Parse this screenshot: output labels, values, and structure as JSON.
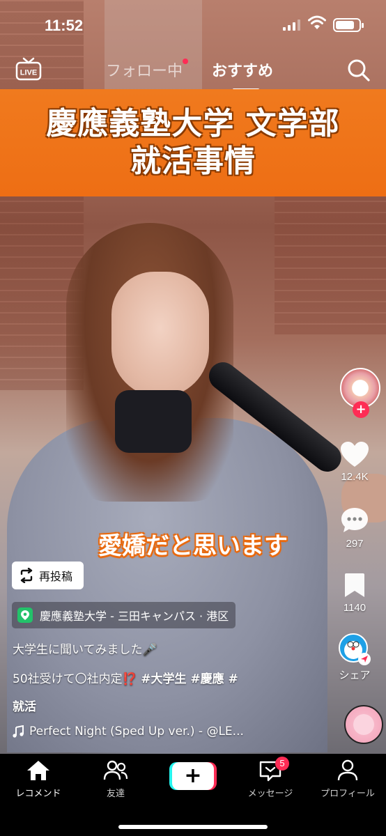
{
  "status_bar": {
    "time": "11:52"
  },
  "top_nav": {
    "live_label": "LIVE",
    "tabs": [
      {
        "label": "フォロー中",
        "has_dot": true
      },
      {
        "label": "おすすめ",
        "active": true
      }
    ]
  },
  "banner": {
    "line1": "慶應義塾大学 文学部",
    "line2": "就活事情"
  },
  "subtitle": "愛嬌だと思います",
  "actions": {
    "likes": "12.4K",
    "comments": "297",
    "bookmarks": "1140",
    "share_label": "シェア"
  },
  "repost": {
    "label": "再投稿"
  },
  "location": {
    "label": "慶應義塾大学 - 三田キャンパス · 港区"
  },
  "caption": {
    "line1": "大学生に聞いてみました🎤",
    "line2_text": "50社受けて〇社内定⁉️",
    "line2_tags": "#大学生 #慶應 #",
    "line3": "就活"
  },
  "music": {
    "text": "Perfect Night (Sped Up ver.) - @LE..."
  },
  "bottom_nav": {
    "items": [
      {
        "label": "レコメンド",
        "active": true
      },
      {
        "label": "友達"
      },
      {
        "label": ""
      },
      {
        "label": "メッセージ",
        "badge": "5"
      },
      {
        "label": "プロフィール"
      }
    ]
  },
  "colors": {
    "banner": "#ee6e14",
    "accent": "#fe2c55",
    "cyan": "#25f4ee",
    "location_pin": "#23c26a"
  }
}
